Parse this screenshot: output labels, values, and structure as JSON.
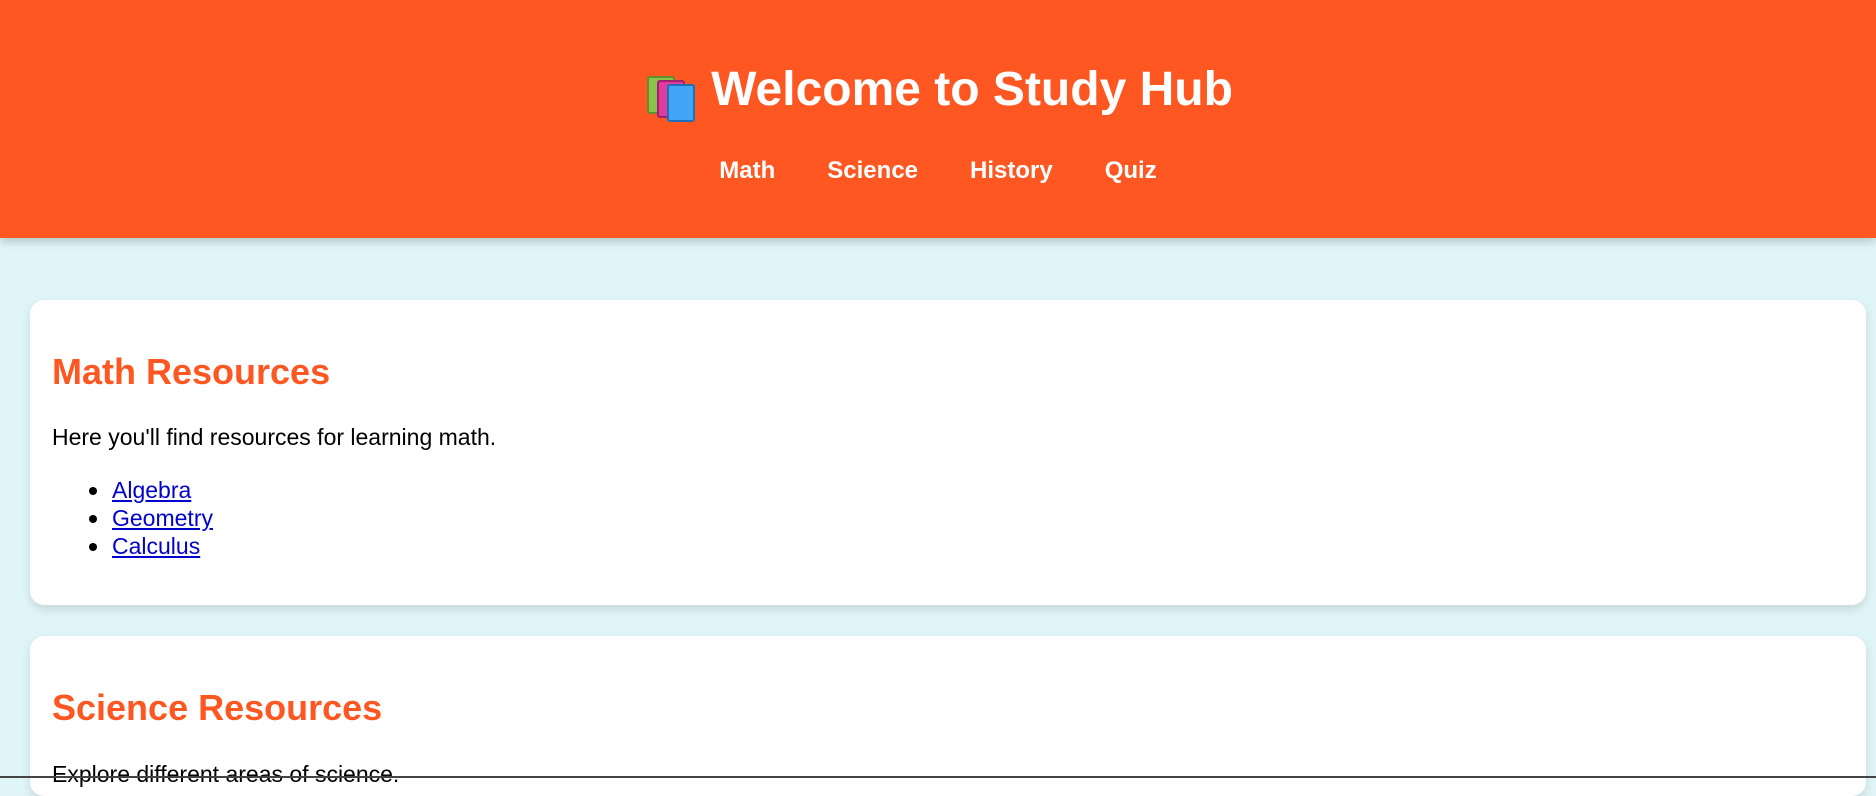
{
  "header": {
    "icon": "books-icon",
    "title": "Welcome to Study Hub",
    "nav": [
      "Math",
      "Science",
      "History",
      "Quiz"
    ],
    "bg_color": "#ff5722"
  },
  "sections": {
    "math": {
      "title": "Math Resources",
      "description": "Here you'll find resources for learning math.",
      "links": [
        "Algebra",
        "Geometry",
        "Calculus"
      ]
    },
    "science": {
      "title": "Science Resources",
      "description": "Explore different areas of science."
    }
  },
  "colors": {
    "accent": "#ff5722",
    "background": "#dff5f7",
    "link": "#0000cc"
  }
}
